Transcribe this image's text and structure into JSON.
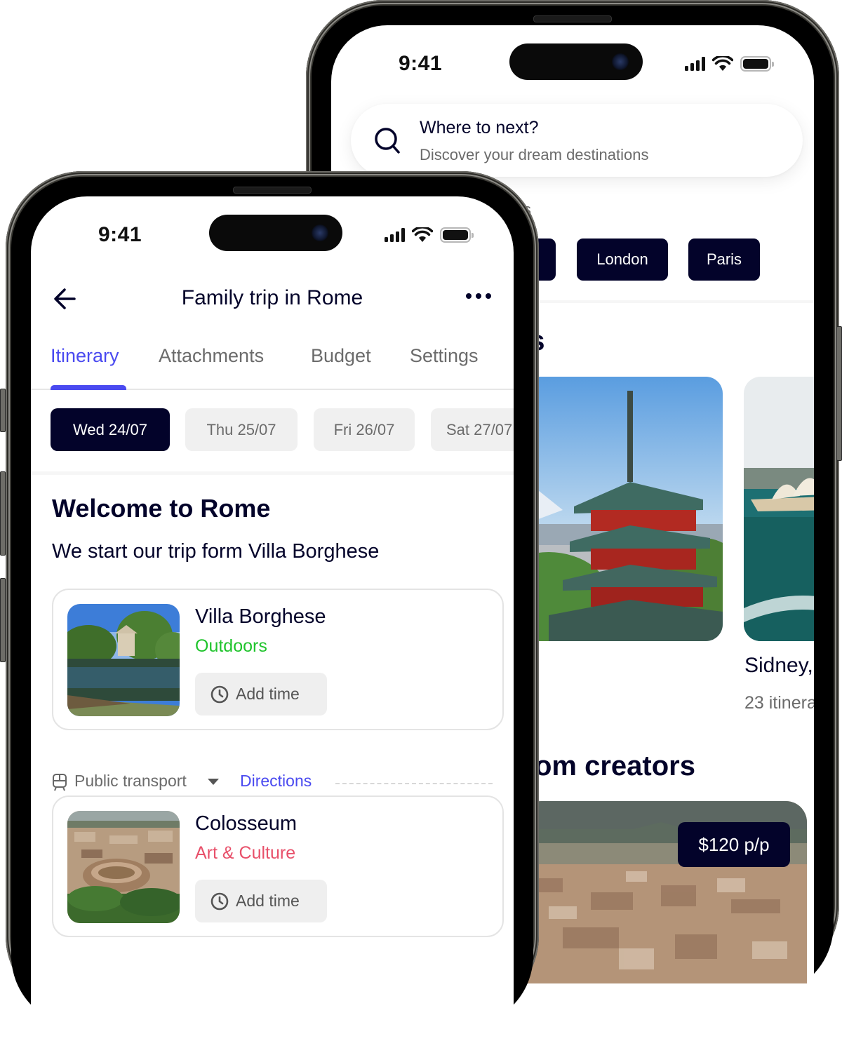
{
  "back_phone": {
    "status": {
      "time": "9:41"
    },
    "search": {
      "title": "Where to next?",
      "subtitle": "Discover your dream destinations"
    },
    "section_label_partial": "s",
    "city_chips": [
      {
        "label": ""
      },
      {
        "label": "London"
      },
      {
        "label": "Paris"
      }
    ],
    "destinations_heading_partial": "es",
    "destinations": [
      {
        "image": "japan-pagoda-photo",
        "title": "",
        "subtitle": ""
      },
      {
        "image": "sydney-opera-house-photo",
        "title": "Sidney,",
        "subtitle": "23 itinera"
      }
    ],
    "creators_heading_partial": "om creators",
    "creator_card": {
      "image": "rome-cityscape-photo",
      "price": "$120 p/p"
    }
  },
  "front_phone": {
    "status": {
      "time": "9:41"
    },
    "header": {
      "title": "Family trip in Rome",
      "back_icon": "arrow-left-icon",
      "more_icon": "more-horizontal-icon"
    },
    "tabs": [
      {
        "label": "Itinerary",
        "active": true
      },
      {
        "label": "Attachments",
        "active": false
      },
      {
        "label": "Budget",
        "active": false
      },
      {
        "label": "Settings",
        "active": false
      }
    ],
    "dates": [
      {
        "label": "Wed 24/07",
        "active": true
      },
      {
        "label": "Thu 25/07",
        "active": false
      },
      {
        "label": "Fri 26/07",
        "active": false
      },
      {
        "label": "Sat 27/07",
        "active": false
      }
    ],
    "welcome": {
      "heading": "Welcome to Rome",
      "text": "We start our trip form Villa Borghese"
    },
    "places": [
      {
        "name": "Villa Borghese",
        "category": "Outdoors",
        "category_color": "#1fc42c",
        "add_time_label": "Add time",
        "image": "villa-borghese-lake-photo"
      },
      {
        "name": "Colosseum",
        "category": "Art & Culture",
        "category_color": "#e8506a",
        "add_time_label": "Add time",
        "image": "colosseum-aerial-photo"
      }
    ],
    "transport": {
      "mode": "Public transport",
      "directions_label": "Directions"
    }
  },
  "colors": {
    "navy": "#03032a",
    "accent_blue": "#4a4af0",
    "chip_gray": "#f0f0f0",
    "text_gray": "#6b6b6b"
  }
}
